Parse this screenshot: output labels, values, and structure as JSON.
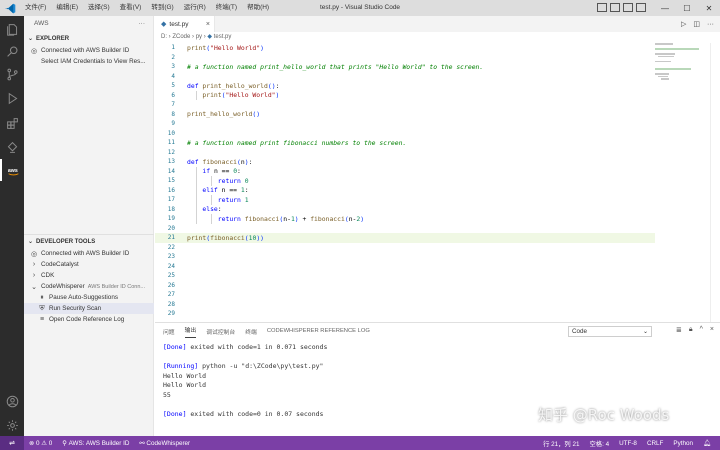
{
  "titlebar": {
    "menu": [
      "文件(F)",
      "编辑(E)",
      "选择(S)",
      "查看(V)",
      "转到(G)",
      "运行(R)",
      "终端(T)",
      "帮助(H)"
    ],
    "title": "test.py - Visual Studio Code",
    "controls": {
      "minimize": "—",
      "maximize": "☐",
      "close": "✕"
    }
  },
  "sidebar": {
    "header": "AWS",
    "explorer": {
      "title": "EXPLORER",
      "items": [
        "Connected with AWS Builder ID",
        "Select IAM Credentials to View Res..."
      ]
    },
    "developer_tools": {
      "title": "DEVELOPER TOOLS",
      "connected": "Connected with AWS Builder ID",
      "codecatalyst": "CodeCatalyst",
      "cdk": "CDK",
      "codewhisperer": "CodeWhisperer",
      "codewhisperer_sub": "AWS Builder ID Conn...",
      "pause": "Pause Auto-Suggestions",
      "scan": "Run Security Scan",
      "reference_log": "Open Code Reference Log"
    }
  },
  "editor": {
    "tab": "test.py",
    "breadcrumb": [
      "D:",
      "ZCode",
      "py",
      "test.py"
    ],
    "lines": [
      {
        "n": "1",
        "code": "print(\"Hello World\")"
      },
      {
        "n": "2",
        "code": ""
      },
      {
        "n": "3",
        "code": "# a function named print_hello_world that prints \"Hello World\" to the screen."
      },
      {
        "n": "4",
        "code": ""
      },
      {
        "n": "5",
        "code": "def print_hello_world():"
      },
      {
        "n": "6",
        "code": "    print(\"Hello World\")"
      },
      {
        "n": "7",
        "code": ""
      },
      {
        "n": "8",
        "code": "print_hello_world()"
      },
      {
        "n": "9",
        "code": ""
      },
      {
        "n": "10",
        "code": ""
      },
      {
        "n": "11",
        "code": "# a function named print fibonacci numbers to the screen."
      },
      {
        "n": "12",
        "code": ""
      },
      {
        "n": "13",
        "code": "def fibonacci(n):"
      },
      {
        "n": "14",
        "code": "    if n == 0:"
      },
      {
        "n": "15",
        "code": "        return 0"
      },
      {
        "n": "16",
        "code": "    elif n == 1:"
      },
      {
        "n": "17",
        "code": "        return 1"
      },
      {
        "n": "18",
        "code": "    else:"
      },
      {
        "n": "19",
        "code": "        return fibonacci(n-1) + fibonacci(n-2)"
      },
      {
        "n": "20",
        "code": ""
      },
      {
        "n": "21",
        "code": "print(fibonacci(10))"
      },
      {
        "n": "22",
        "code": ""
      },
      {
        "n": "23",
        "code": ""
      },
      {
        "n": "24",
        "code": ""
      },
      {
        "n": "25",
        "code": ""
      },
      {
        "n": "26",
        "code": ""
      },
      {
        "n": "27",
        "code": ""
      },
      {
        "n": "28",
        "code": ""
      },
      {
        "n": "29",
        "code": ""
      }
    ]
  },
  "panel": {
    "tabs": [
      "问题",
      "输出",
      "调试控制台",
      "终端",
      "CODEWHISPERER REFERENCE LOG"
    ],
    "active_tab": "输出",
    "select": "Code",
    "output": [
      "[Done] exited with code=1 in 0.071 seconds",
      "",
      "[Running] python -u \"d:\\ZCode\\py\\test.py\"",
      "Hello World",
      "Hello World",
      "55",
      "",
      "[Done] exited with code=0 in 0.07 seconds"
    ]
  },
  "statusbar": {
    "errors": "0",
    "warnings": "0",
    "aws": "AWS: AWS Builder ID",
    "codewhisperer": "CodeWhisperer",
    "position": "行 21，列 21",
    "spaces": "空格: 4",
    "encoding": "UTF-8",
    "eol": "CRLF",
    "language": "Python"
  },
  "watermark": "知乎 @Roc Woods",
  "colors": {
    "statusbar": "#7b3fa6",
    "activitybar": "#2c2c2c",
    "titlebar": "#dddddd"
  }
}
